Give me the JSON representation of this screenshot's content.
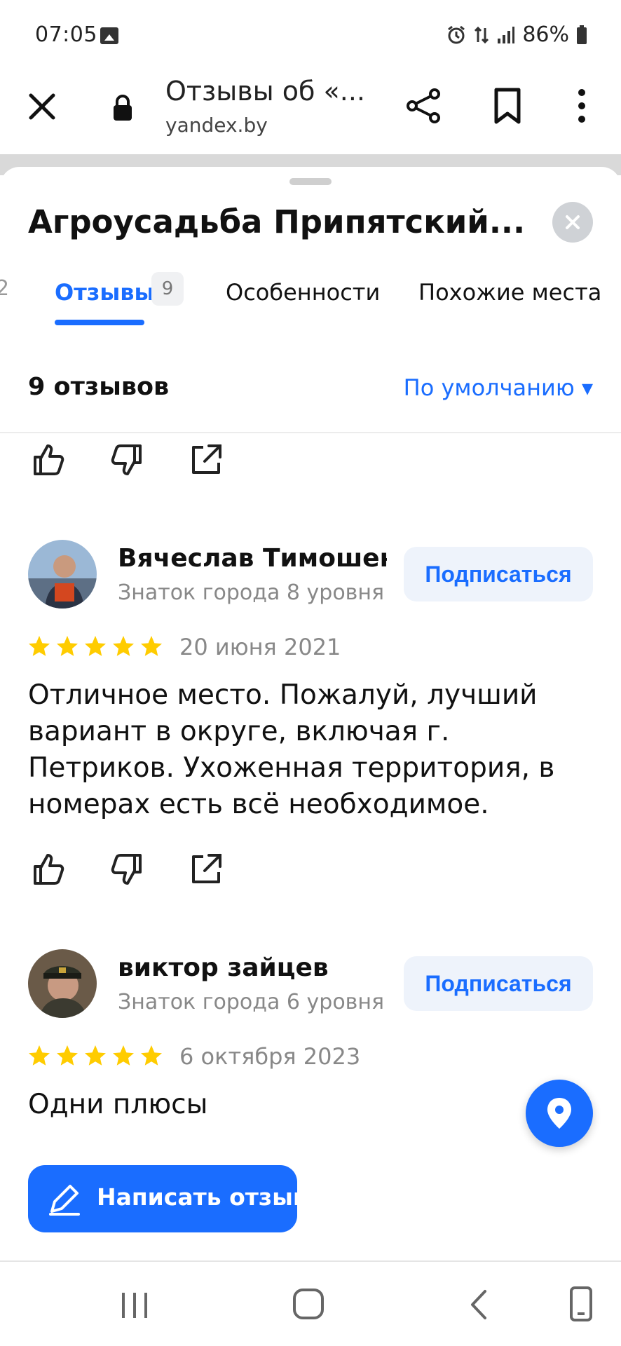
{
  "status_bar": {
    "time": "07:05",
    "battery": "86%",
    "icons": [
      "gallery-icon",
      "alarm-icon",
      "data-arrows-icon",
      "signal-icon",
      "battery-icon"
    ]
  },
  "browser": {
    "title": "Отзывы об «...",
    "domain": "yandex.by",
    "icons": [
      "close-icon",
      "lock-icon",
      "share-icon",
      "bookmark-icon",
      "more-vertical-icon"
    ]
  },
  "place": {
    "title": "Агроусадьба Припятский..."
  },
  "tabs": {
    "prev_partial": "2",
    "reviews_label": "Отзывы",
    "reviews_count": "9",
    "features_label": "Особенности",
    "similar_label": "Похожие места"
  },
  "reviews_header": {
    "count_label": "9 отзывов",
    "sort_label": "По умолчанию ▾"
  },
  "reviews": [
    {
      "author": "Вячеслав Тимошенко",
      "level": "Знаток города 8 уровня",
      "subscribe_label": "Подписаться",
      "rating": 5,
      "date": "20 июня 2021",
      "text": "Отличное место. Пожалуй, лучший вариант в округе, включая г. Петриков. Ухоженная территория, в номерах есть всё необходимое."
    },
    {
      "author": "виктор зайцев",
      "level": "Знаток города 6 уровня",
      "subscribe_label": "Подписаться",
      "rating": 5,
      "date": "6 октября 2023",
      "text": "Одни плюсы"
    }
  ],
  "write_review_label": "Написать отзыв",
  "colors": {
    "accent": "#1a6dff",
    "star": "#ffcc00",
    "muted": "#888888"
  }
}
